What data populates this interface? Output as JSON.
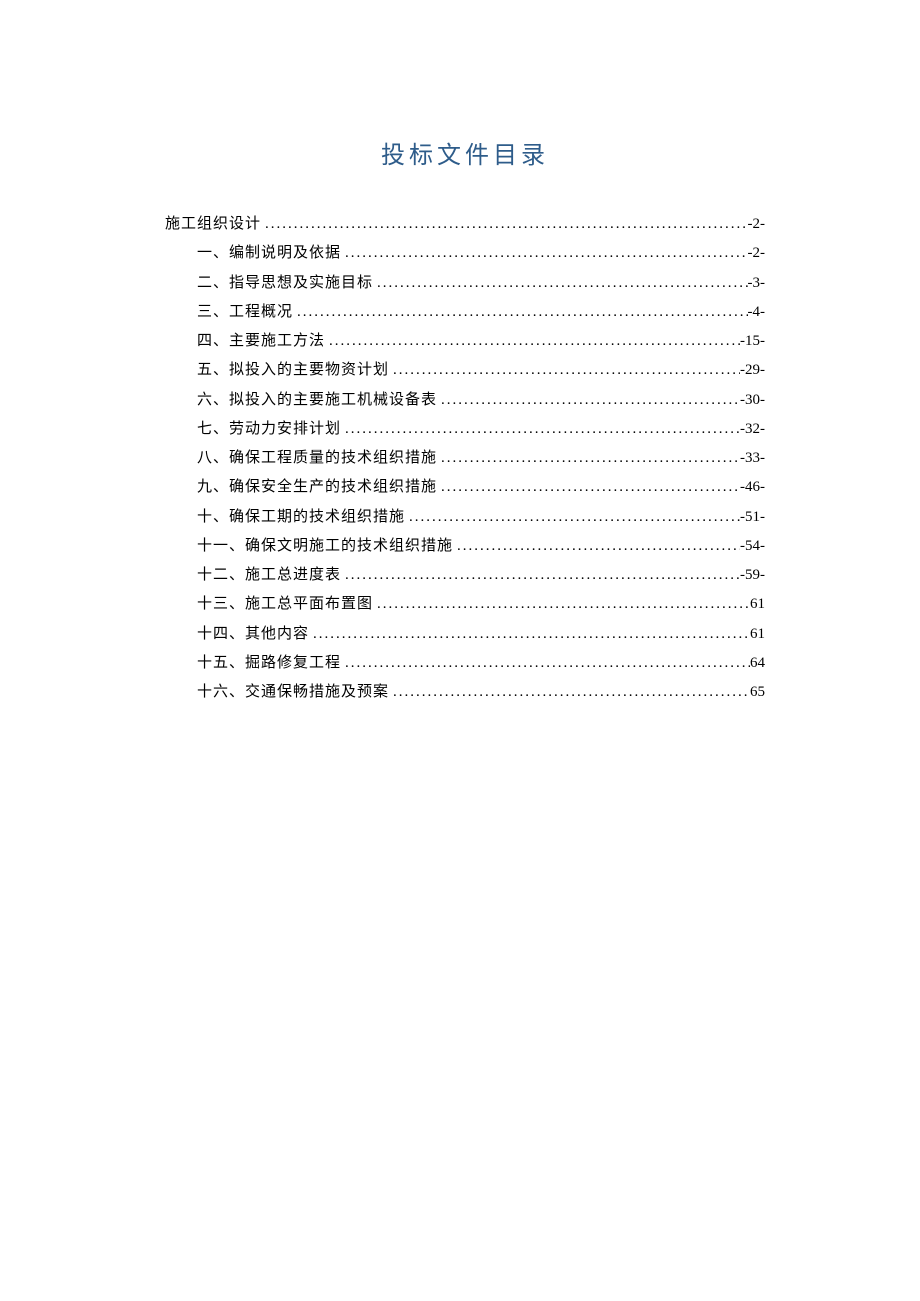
{
  "title": "投标文件目录",
  "toc": [
    {
      "level": 0,
      "label": "施工组织设计",
      "page": "-2-"
    },
    {
      "level": 1,
      "label": "一、编制说明及依据 ",
      "page": "-2-"
    },
    {
      "level": 1,
      "label": "二、指导思想及实施目标 ",
      "page": "-3-"
    },
    {
      "level": 1,
      "label": "三、工程概况 ",
      "page": "-4-"
    },
    {
      "level": 1,
      "label": "四、主要施工方法 ",
      "page": "-15-"
    },
    {
      "level": 1,
      "label": "五、拟投入的主要物资计划 ",
      "page": "-29-"
    },
    {
      "level": 1,
      "label": "六、拟投入的主要施工机械设备表 ",
      "page": "-30-"
    },
    {
      "level": 1,
      "label": "七、劳动力安排计划 ",
      "page": "-32-"
    },
    {
      "level": 1,
      "label": "八、确保工程质量的技术组织措施 ",
      "page": "-33-"
    },
    {
      "level": 1,
      "label": "九、确保安全生产的技术组织措施 ",
      "page": "-46-"
    },
    {
      "level": 1,
      "label": "十、确保工期的技术组织措施 ",
      "page": "-51-"
    },
    {
      "level": 1,
      "label": "十一、确保文明施工的技术组织措施 ",
      "page": "-54-"
    },
    {
      "level": 1,
      "label": "十二、施工总进度表 ",
      "page": "-59-"
    },
    {
      "level": 1,
      "label": "十三、施工总平面布置图",
      "page": " 61"
    },
    {
      "level": 1,
      "label": "十四、其他内容",
      "page": " 61"
    },
    {
      "level": 1,
      "label": "十五、掘路修复工程",
      "page": " 64"
    },
    {
      "level": 1,
      "label": "十六、交通保畅措施及预案",
      "page": " 65"
    }
  ]
}
